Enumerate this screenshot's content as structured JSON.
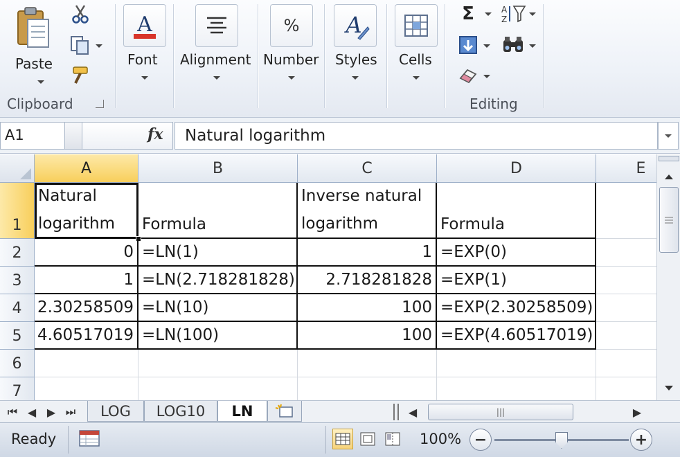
{
  "ribbon": {
    "clipboard": {
      "paste_label": "Paste",
      "group_label": "Clipboard",
      "icons": [
        "paste-icon",
        "cut-icon",
        "copy-icon",
        "format-painter-icon",
        "dialog-launcher-icon"
      ]
    },
    "font_label": "Font",
    "alignment_label": "Alignment",
    "number_label": "Number",
    "number_icon_text": "%",
    "styles_label": "Styles",
    "cells_label": "Cells",
    "editing": {
      "group_label": "Editing",
      "autosum_glyph": "Σ",
      "icons": [
        "autosum-icon",
        "sort-filter-icon",
        "fill-icon",
        "find-select-icon",
        "clear-icon"
      ]
    }
  },
  "formula_bar": {
    "name_box": "A1",
    "fx_label": "fx",
    "content": "Natural logarithm"
  },
  "grid": {
    "columns": [
      "A",
      "B",
      "C",
      "D",
      "E"
    ],
    "selected_column": "A",
    "rows": [
      "1",
      "2",
      "3",
      "4",
      "5",
      "6",
      "7"
    ],
    "selected_row": "1",
    "cells": {
      "A1": "Natural logarithm",
      "B1": "Formula",
      "C1": "Inverse natural logarithm",
      "D1": "Formula",
      "A2": "0",
      "B2": "=LN(1)",
      "C2": "1",
      "D2": "=EXP(0)",
      "A3": "1",
      "B3": "=LN(2.718281828)",
      "C3": "2.718281828",
      "D3": "=EXP(1)",
      "A4": "2.30258509",
      "B4": "=LN(10)",
      "C4": "100",
      "D4": "=EXP(2.30258509)",
      "A5": "4.60517019",
      "B5": "=LN(100)",
      "C5": "100",
      "D5": "=EXP(4.60517019)"
    }
  },
  "sheet_tabs": {
    "tabs": [
      "LOG",
      "LOG10",
      "LN"
    ],
    "active": "LN"
  },
  "status_bar": {
    "ready": "Ready",
    "zoom": "100%",
    "zoom_minus": "−",
    "zoom_plus": "+",
    "active_view": "normal"
  },
  "colors": {
    "selected_header": "#f8cf5c",
    "grid_line": "#d4d9e0",
    "ribbon_bg": "#eef2f8"
  }
}
